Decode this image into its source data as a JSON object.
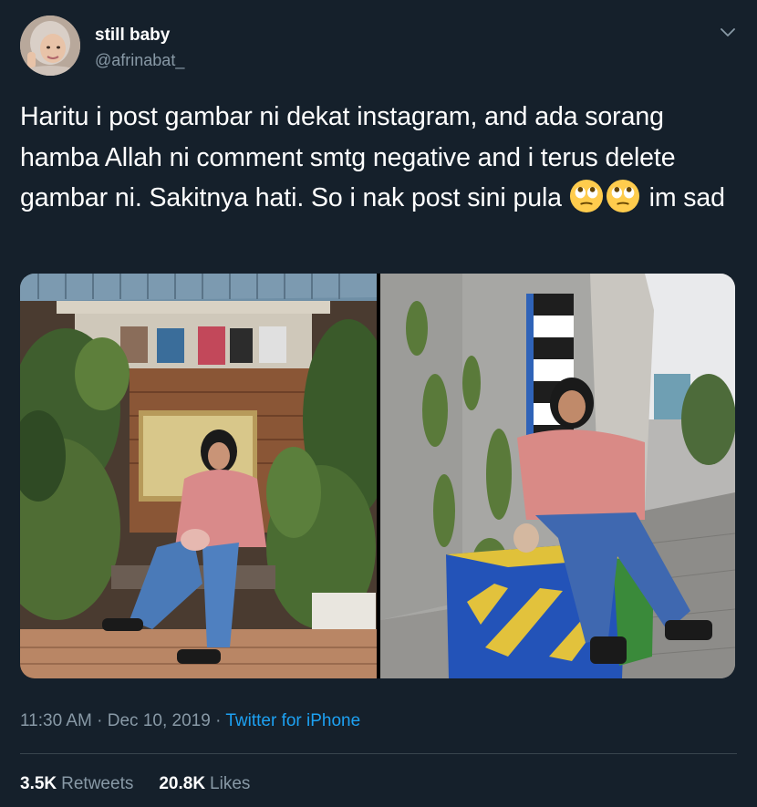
{
  "colors": {
    "background": "#15202b",
    "text": "#ffffff",
    "secondary": "#8899a6",
    "link": "#1da1f2",
    "divider": "#38444d"
  },
  "author": {
    "display_name": "still baby",
    "handle": "@afrinabat_"
  },
  "tweet": {
    "text_main": "Haritu i post gambar ni dekat instagram, and ada sorang hamba Allah ni comment smtg negative and i terus delete gambar ni. Sakitnya hati. So i nak post sini pula",
    "emojis": [
      "face-with-rolling-eyes-emoji",
      "face-with-rolling-eyes-emoji"
    ],
    "text_end": "im sad"
  },
  "meta": {
    "time": "11:30 AM",
    "separator1": " · ",
    "date": "Dec 10, 2019",
    "separator2": " · ",
    "source": "Twitter for iPhone"
  },
  "stats": {
    "retweets_count": "3.5K",
    "retweets_label": "Retweets",
    "likes_count": "20.8K",
    "likes_label": "Likes"
  },
  "icons": {
    "caret": "chevron-down-icon"
  }
}
